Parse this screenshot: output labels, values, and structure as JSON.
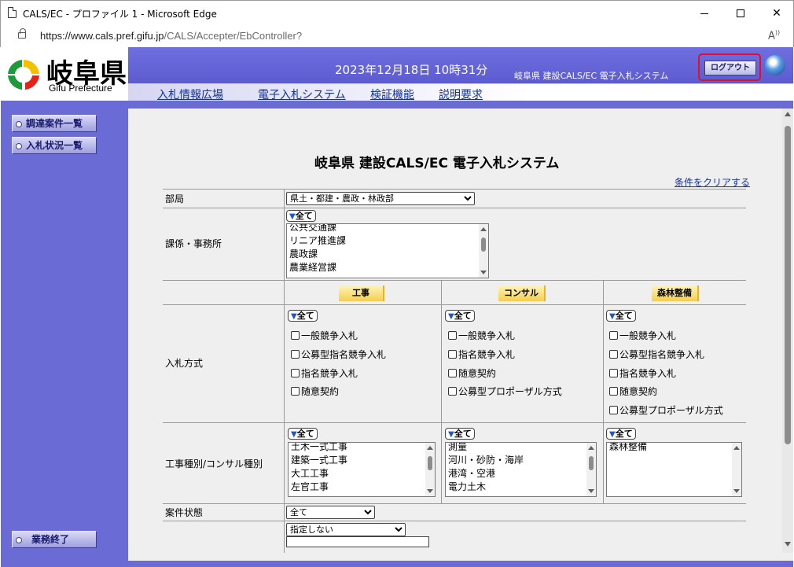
{
  "window": {
    "title": "CALS/EC - プロファイル 1 - Microsoft Edge",
    "url_host": "https://www.cals.pref.gifu.jp",
    "url_path": "/CALS/Accepter/EbController?"
  },
  "header": {
    "logo_jp": "岐阜県",
    "logo_en": "Gifu Prefecture",
    "datetime": "2023年12月18日 10時31分",
    "org_name": "岐阜県 建設CALS/EC 電子入札システム",
    "logout_label": "ログアウト",
    "nav": [
      "入札情報広場",
      "電子入札システム",
      "検証機能",
      "説明要求"
    ]
  },
  "sidebar": {
    "items": [
      "調達案件一覧",
      "入札状況一覧"
    ],
    "end_label": "業務終了"
  },
  "main": {
    "title": "岐阜県 建設CALS/EC 電子入札システム",
    "clear_link": "条件をクリアする",
    "all_label": "全て",
    "department": {
      "label": "部局",
      "value": "県土・都建・農政・林政部"
    },
    "section": {
      "label": "課係・事務所",
      "items": [
        "公共交通課",
        "リニア推進課",
        "農政課",
        "農業経営課"
      ]
    },
    "columns": [
      "工事",
      "コンサル",
      "森林整備"
    ],
    "bid_method": {
      "label": "入札方式",
      "koji": [
        "一般競争入札",
        "公募型指名競争入札",
        "指名競争入札",
        "随意契約"
      ],
      "consul": [
        "一般競争入札",
        "指名競争入札",
        "随意契約",
        "公募型プロポーザル方式"
      ],
      "forest": [
        "一般競争入札",
        "公募型指名競争入札",
        "指名競争入札",
        "随意契約",
        "公募型プロポーザル方式"
      ]
    },
    "work_type": {
      "label": "工事種別/コンサル種別",
      "koji": [
        "土木一式工事",
        "建築一式工事",
        "大工工事",
        "左官工事"
      ],
      "consul": [
        "測量",
        "河川・砂防・海岸",
        "港湾・空港",
        "電力土木"
      ],
      "forest": [
        "森林整備"
      ]
    },
    "status": {
      "label": "案件状態",
      "value": "全て"
    },
    "next_select": {
      "value": "指定しない"
    }
  },
  "colors": {
    "frame_blue": "#6b6bd6",
    "link_blue": "#1330a0",
    "header_gold": "#f3cf52",
    "logout_highlight": "#e0102a"
  },
  "icons": [
    "page-icon",
    "lock-icon",
    "read-aloud-icon",
    "ie-icon",
    "logo-mark-icon"
  ]
}
